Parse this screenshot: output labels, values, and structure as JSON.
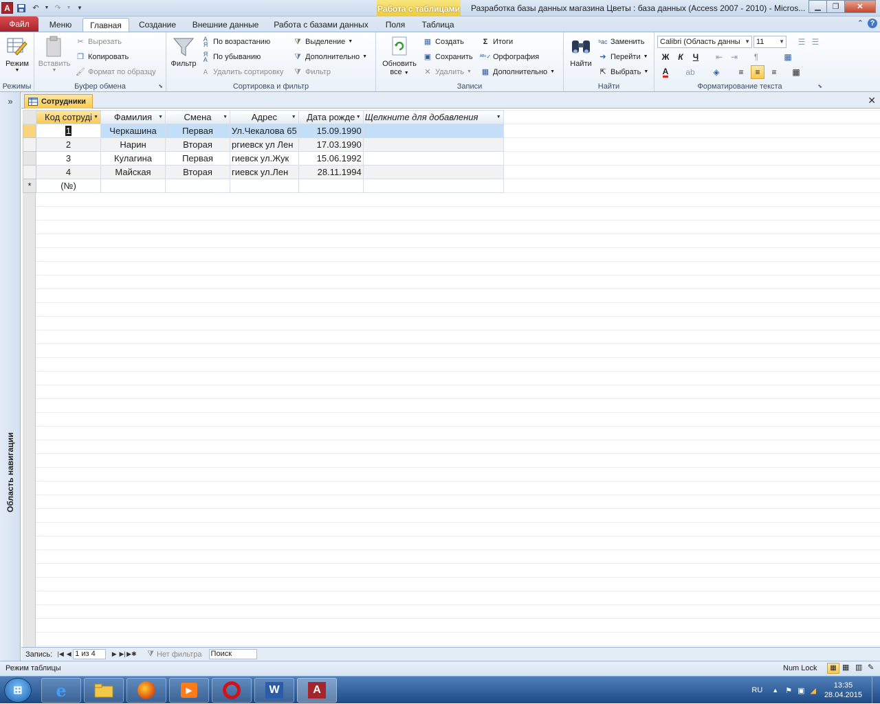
{
  "window": {
    "app_icon": "A",
    "context_tab": "Работа с таблицами",
    "title": "Разработка базы данных магазина Цветы : база данных (Access 2007 - 2010)  -  Micros..."
  },
  "tabs": {
    "file": "Файл",
    "menu": "Меню",
    "home": "Главная",
    "create": "Создание",
    "external": "Внешние данные",
    "database": "Работа с базами данных",
    "fields": "Поля",
    "table": "Таблица"
  },
  "ribbon": {
    "views": {
      "mode": "Режим",
      "label": "Режимы"
    },
    "clipboard": {
      "paste": "Вставить",
      "cut": "Вырезать",
      "copy": "Копировать",
      "format_painter": "Формат по образцу",
      "label": "Буфер обмена"
    },
    "sort_filter": {
      "filter": "Фильтр",
      "ascending": "По возрастанию",
      "descending": "По убыванию",
      "remove_sort": "Удалить сортировку",
      "selection": "Выделение",
      "advanced": "Дополнительно",
      "toggle_filter": "Фильтр",
      "label": "Сортировка и фильтр"
    },
    "records": {
      "refresh_line1": "Обновить",
      "refresh_line2": "все",
      "new": "Создать",
      "save": "Сохранить",
      "delete": "Удалить",
      "totals": "Итоги",
      "spelling": "Орфография",
      "more": "Дополнительно",
      "label": "Записи"
    },
    "find": {
      "find": "Найти",
      "replace": "Заменить",
      "goto": "Перейти",
      "select": "Выбрать",
      "label": "Найти"
    },
    "text_format": {
      "font": "Calibri (Область данны",
      "size": "11",
      "bold": "Ж",
      "italic": "К",
      "underline": "Ч",
      "label": "Форматирование текста"
    }
  },
  "nav_pane": {
    "label": "Область навигации"
  },
  "document": {
    "tab_title": "Сотрудники"
  },
  "table": {
    "columns": [
      "Код сотруді",
      "Фамилия",
      "Смена",
      "Адрес",
      "Дата рожде",
      "Щелкните для добавления"
    ],
    "rows": [
      {
        "id": "1",
        "surname": "Черкашина",
        "shift": "Первая",
        "address": "Ул.Чекалова 65",
        "dob": "15.09.1990"
      },
      {
        "id": "2",
        "surname": "Нарин",
        "shift": "Вторая",
        "address": "ргиевск ул Лен",
        "dob": "17.03.1990"
      },
      {
        "id": "3",
        "surname": "Кулагина",
        "shift": "Первая",
        "address": "гиевск ул.Жук",
        "dob": "15.06.1992"
      },
      {
        "id": "4",
        "surname": "Майская",
        "shift": "Вторая",
        "address": "гиевск ул.Лен",
        "dob": "28.11.1994"
      }
    ],
    "new_row_marker": "*",
    "new_row_placeholder": "(№)"
  },
  "record_nav": {
    "label": "Запись:",
    "position": "1 из 4",
    "no_filter": "Нет фильтра",
    "search": "Поиск"
  },
  "status": {
    "mode": "Режим таблицы",
    "numlock": "Num Lock"
  },
  "taskbar": {
    "lang": "RU",
    "time": "13:35",
    "date": "28.04.2015"
  },
  "colors": {
    "accent": "#f8c94f",
    "file_tab": "#a4262c",
    "selected_row": "#c4dffa"
  }
}
